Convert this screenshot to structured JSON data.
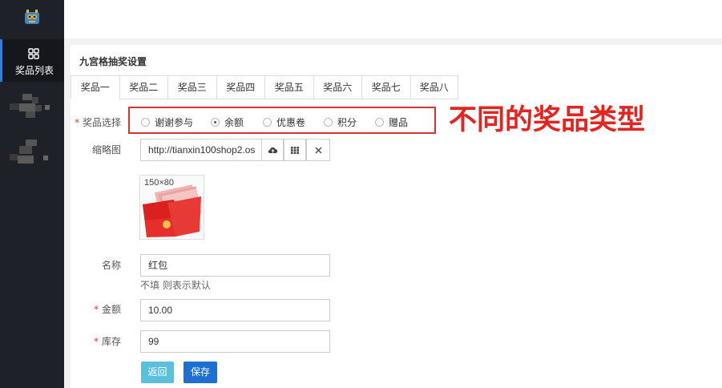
{
  "sidebar": {
    "logo_icon": "robot-logo-icon",
    "active_item": {
      "icon": "grid-icon",
      "label": "奖品列表"
    },
    "colors": {
      "bg": "#1f2128",
      "active_bar": "#2e7de1"
    }
  },
  "panel": {
    "title": "九宫格抽奖设置",
    "tabs": [
      "奖品一",
      "奖品二",
      "奖品三",
      "奖品四",
      "奖品五",
      "奖品六",
      "奖品七",
      "奖品八"
    ],
    "active_tab": 0
  },
  "form": {
    "prize_type": {
      "label": "奖品选择",
      "required_mark": "*",
      "options": [
        "谢谢参与",
        "余额",
        "优惠卷",
        "积分",
        "赠品"
      ],
      "selected": "余额"
    },
    "thumbnail": {
      "label": "缩略图",
      "value": "http://tianxin100shop2.os",
      "caption": "150×80",
      "icons": [
        "cloud-upload-icon",
        "grid-icon",
        "close-icon"
      ]
    },
    "name": {
      "label": "名称",
      "value": "红包",
      "help": "不填 则表示默认"
    },
    "amount": {
      "label": "金额",
      "required_mark": "*",
      "value": "10.00"
    },
    "stock": {
      "label": "库存",
      "required_mark": "*",
      "value": "99"
    }
  },
  "annotation": {
    "text": "不同的奖品类型",
    "color": "#e8231f"
  },
  "buttons": {
    "back": "返回",
    "save": "保存"
  }
}
